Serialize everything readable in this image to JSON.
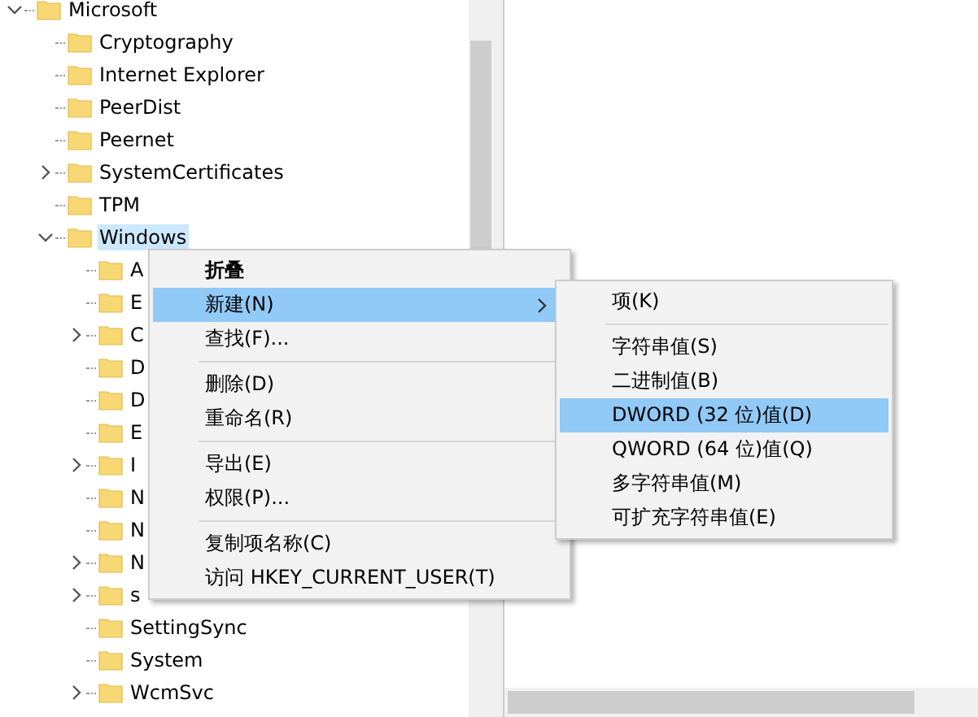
{
  "tree": [
    {
      "label": "Microsoft",
      "expanded": true,
      "selected": false,
      "children": [
        {
          "label": "Cryptography",
          "selected": false
        },
        {
          "label": "Internet Explorer",
          "selected": false
        },
        {
          "label": "PeerDist",
          "selected": false
        },
        {
          "label": "Peernet",
          "selected": false
        },
        {
          "label": "SystemCertificates",
          "expanded": false,
          "selected": false
        },
        {
          "label": "TPM",
          "selected": false
        },
        {
          "label": "Windows",
          "expanded": true,
          "selected": true,
          "children": [
            {
              "label": "A",
              "selected": false
            },
            {
              "label": "E",
              "selected": false
            },
            {
              "label": "C",
              "expanded": false,
              "selected": false
            },
            {
              "label": "D",
              "selected": false
            },
            {
              "label": "D",
              "selected": false
            },
            {
              "label": "E",
              "selected": false
            },
            {
              "label": "I",
              "expanded": false,
              "selected": false
            },
            {
              "label": "N",
              "selected": false
            },
            {
              "label": "N",
              "selected": false
            },
            {
              "label": "N",
              "expanded": false,
              "selected": false
            },
            {
              "label": "s",
              "expanded": false,
              "selected": false
            },
            {
              "label": "SettingSync",
              "selected": false
            },
            {
              "label": "System",
              "selected": false
            },
            {
              "label": "WcmSvc",
              "expanded": false,
              "selected": false
            }
          ]
        }
      ]
    }
  ],
  "context_menu": [
    {
      "kind": "item",
      "label": "折叠",
      "default": true,
      "selected": false,
      "submenu": false
    },
    {
      "kind": "item",
      "label": "新建(N)",
      "default": false,
      "selected": true,
      "submenu": true
    },
    {
      "kind": "item",
      "label": "查找(F)...",
      "default": false,
      "selected": false,
      "submenu": false
    },
    {
      "kind": "separator"
    },
    {
      "kind": "item",
      "label": "删除(D)",
      "default": false,
      "selected": false,
      "submenu": false
    },
    {
      "kind": "item",
      "label": "重命名(R)",
      "default": false,
      "selected": false,
      "submenu": false
    },
    {
      "kind": "separator"
    },
    {
      "kind": "item",
      "label": "导出(E)",
      "default": false,
      "selected": false,
      "submenu": false
    },
    {
      "kind": "item",
      "label": "权限(P)...",
      "default": false,
      "selected": false,
      "submenu": false
    },
    {
      "kind": "separator"
    },
    {
      "kind": "item",
      "label": "复制项名称(C)",
      "default": false,
      "selected": false,
      "submenu": false
    },
    {
      "kind": "item",
      "label": "访问 HKEY_CURRENT_USER(T)",
      "default": false,
      "selected": false,
      "submenu": false
    }
  ],
  "submenu": [
    {
      "kind": "item",
      "label": "项(K)",
      "selected": false
    },
    {
      "kind": "separator"
    },
    {
      "kind": "item",
      "label": "字符串值(S)",
      "selected": false
    },
    {
      "kind": "item",
      "label": "二进制值(B)",
      "selected": false
    },
    {
      "kind": "item",
      "label": "DWORD (32 位)值(D)",
      "selected": true
    },
    {
      "kind": "item",
      "label": "QWORD (64 位)值(Q)",
      "selected": false
    },
    {
      "kind": "item",
      "label": "多字符串值(M)",
      "selected": false
    },
    {
      "kind": "item",
      "label": "可扩充字符串值(E)",
      "selected": false
    }
  ]
}
